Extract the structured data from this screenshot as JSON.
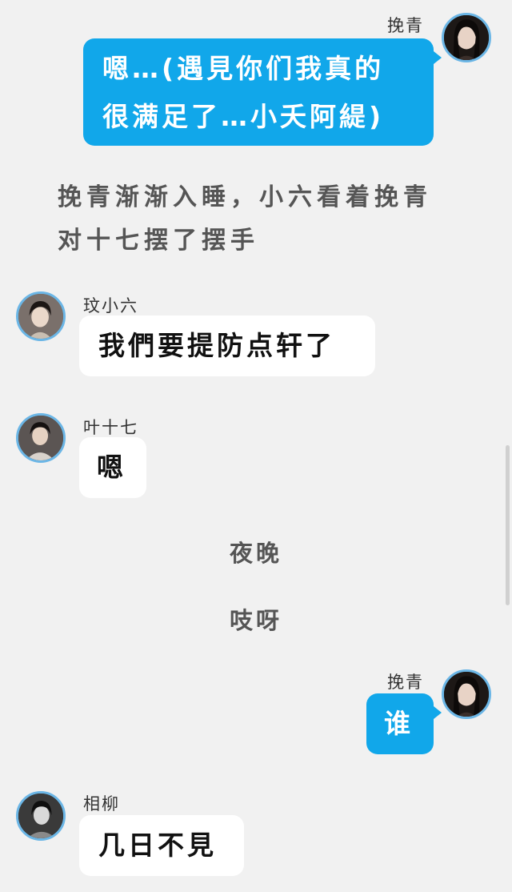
{
  "messages": [
    {
      "sender": "挽青",
      "text_lines": [
        "嗯…(遇見你们我真的",
        "很满足了…小夭阿緹)"
      ]
    },
    {
      "narration_lines": [
        "挽青渐渐入睡，小六看着挽青",
        "对十七摆了摆手"
      ]
    },
    {
      "sender": "玟小六",
      "text": "我們要提防点轩了"
    },
    {
      "sender": "叶十七",
      "text": "嗯"
    },
    {
      "note": "夜晚"
    },
    {
      "note": "吱呀"
    },
    {
      "sender": "挽青",
      "text": "谁"
    },
    {
      "sender": "相柳",
      "text": "几日不見"
    }
  ],
  "colors": {
    "background": "#f1f1f1",
    "outgoing_bubble": "#11a7ea",
    "incoming_bubble": "#ffffff",
    "avatar_border": "#6bb6e6"
  }
}
